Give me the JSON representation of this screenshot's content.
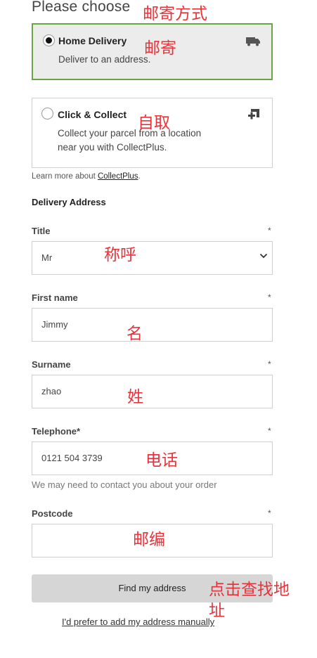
{
  "page": {
    "heading": "Please choose"
  },
  "delivery_options": [
    {
      "title": "Home Delivery",
      "description": "Deliver to an address.",
      "selected": true,
      "icon": "truck-icon"
    },
    {
      "title": "Click & Collect",
      "description_line1": "Collect your parcel from a location",
      "description_line2": "near you with CollectPlus.",
      "selected": false,
      "icon": "collect-plus-icon"
    }
  ],
  "learn_more": {
    "prefix": "Learn more about ",
    "link": "CollectPlus",
    "suffix": "."
  },
  "address": {
    "section_title": "Delivery Address",
    "required_mark": "*",
    "title_field": {
      "label": "Title",
      "value": "Mr"
    },
    "first_name": {
      "label": "First name",
      "value": "Jimmy"
    },
    "surname": {
      "label": "Surname",
      "value": "zhao"
    },
    "telephone": {
      "label": "Telephone*",
      "value": "0121 504 3739",
      "hint": "We may need to contact you about your order"
    },
    "postcode": {
      "label": "Postcode",
      "value": ""
    }
  },
  "actions": {
    "find_address": "Find my address",
    "manual_link": "I'd prefer to add my address manually"
  },
  "annotations": {
    "delivery_method": "邮寄方式",
    "post": "邮寄",
    "pickup": "自取",
    "title": "称呼",
    "first_name": "名",
    "surname": "姓",
    "phone": "电话",
    "postcode": "邮编",
    "click_find_line1": "点击查找地",
    "click_find_line2": "址"
  },
  "colors": {
    "selected_border": "#6aa544",
    "annotation": "#e8333a",
    "button_bg": "#d6d6d6"
  }
}
